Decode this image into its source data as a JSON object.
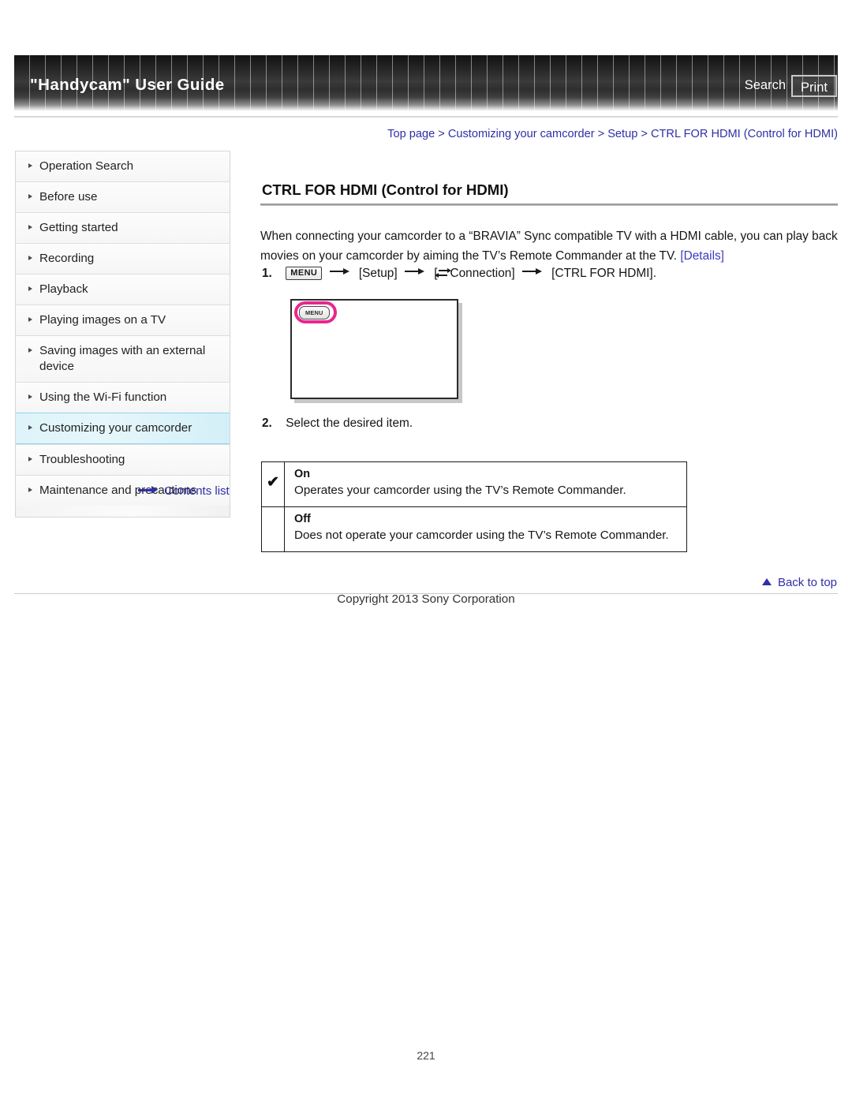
{
  "header": {
    "title": "\"Handycam\" User Guide",
    "search_label": "Search",
    "print_label": "Print"
  },
  "breadcrumb": {
    "text": "Top page > Customizing your camcorder > Setup > CTRL FOR HDMI (Control for HDMI)",
    "items": [
      "Top page",
      "Customizing your camcorder",
      "Setup",
      "CTRL FOR HDMI (Control for HDMI)"
    ],
    "separator": ">",
    "color": "#2f2fa8"
  },
  "sidebar": {
    "items": [
      {
        "label": "Operation Search",
        "active": false
      },
      {
        "label": "Before use",
        "active": false
      },
      {
        "label": "Getting started",
        "active": false
      },
      {
        "label": "Recording",
        "active": false
      },
      {
        "label": "Playback",
        "active": false
      },
      {
        "label": "Playing images on a TV",
        "active": false
      },
      {
        "label": "Saving images with an external device",
        "active": false
      },
      {
        "label": "Using the Wi-Fi function",
        "active": false
      },
      {
        "label": "Customizing your camcorder",
        "active": true
      },
      {
        "label": "Troubleshooting",
        "active": false
      },
      {
        "label": "Maintenance and precautions",
        "active": false
      }
    ],
    "contents_list_label": "Contents list",
    "active_highlight_color": "#ddf4fa",
    "active_border_color": "#8fd6e8"
  },
  "main": {
    "heading": "CTRL FOR HDMI (Control for HDMI)",
    "intro_part1": "When connecting your camcorder to a “BRAVIA” Sync compatible TV with a HDMI cable, you can play back movies on your camcorder by aiming the TV’s Remote Commander at the TV. ",
    "intro_link": "[Details]",
    "steps": [
      {
        "number": "1.",
        "menu_chip": "MENU",
        "token_setup": "[Setup]",
        "token_connection": "Connection]",
        "token_connection_open": "[",
        "token_final": "[CTRL FOR HDMI]."
      },
      {
        "number": "2.",
        "text": "Select the desired item."
      }
    ],
    "illustration": {
      "menu_button_label": "MENU",
      "highlight_color": "#e8268f"
    },
    "options_table": {
      "rows": [
        {
          "checkmark": "✔",
          "name": "On",
          "description": "Operates your camcorder using the TV’s Remote Commander."
        },
        {
          "checkmark": "",
          "name": "Off",
          "description": "Does not operate your camcorder using the TV’s Remote Commander."
        }
      ]
    }
  },
  "footer": {
    "back_to_top_label": "Back to top",
    "copyright": "Copyright 2013 Sony Corporation",
    "page_number": "221"
  }
}
